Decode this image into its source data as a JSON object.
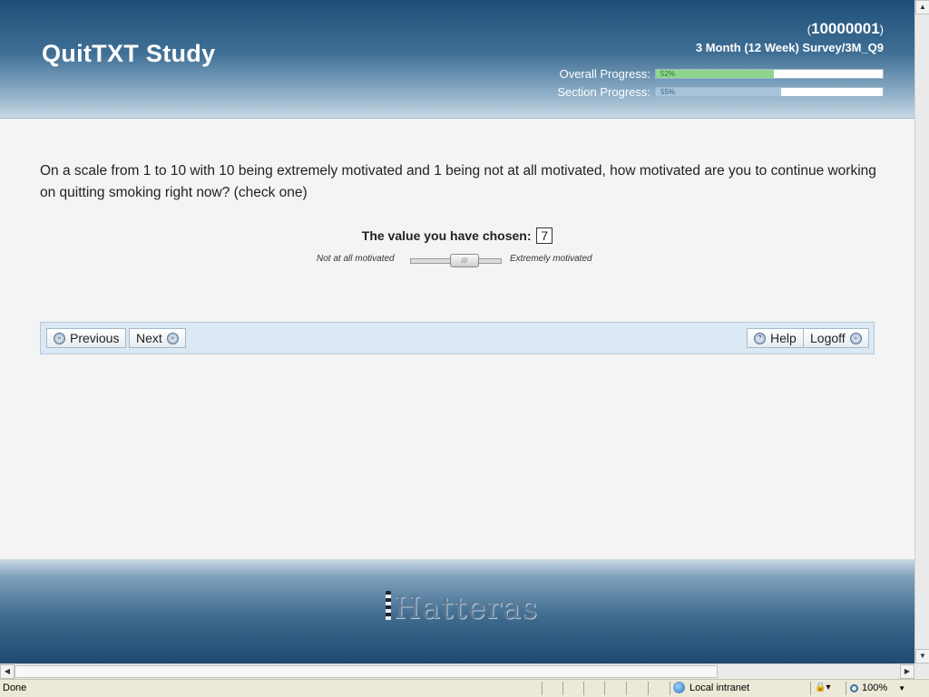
{
  "header": {
    "title": "QuitTXT Study",
    "participant_id_open": "(",
    "participant_id": "10000001",
    "participant_id_close": ")",
    "survey": "3 Month (12 Week) Survey/3M_Q9",
    "overall_progress_label": "Overall Progress:",
    "overall_progress_pct": 52,
    "overall_progress_text": "52%",
    "section_progress_label": "Section Progress:",
    "section_progress_pct": 55,
    "section_progress_text": "55%"
  },
  "question": {
    "text": "On a scale from 1 to 10 with 10 being extremely motivated and 1 being not at all motivated, how motivated are you to continue working on quitting smoking right now? (check one)",
    "chosen_label": "The value you have chosen:",
    "chosen_value": "7",
    "slider_min_label": "Not at all motivated",
    "slider_max_label": "Extremely motivated",
    "slider_value": 7,
    "slider_min": 1,
    "slider_max": 10,
    "slider_grip": "///"
  },
  "nav": {
    "previous": "Previous",
    "next": "Next",
    "help": "Help",
    "logoff": "Logoff",
    "prev_icon_glyph": "«",
    "next_icon_glyph": "»",
    "help_icon_glyph": "?"
  },
  "footer": {
    "logo": "Hatteras"
  },
  "scrollbars": {
    "up": "▲",
    "down": "▼",
    "left": "◀",
    "right": "▶"
  },
  "statusbar": {
    "status": "Done",
    "zone": "Local intranet",
    "zoom": "100%",
    "protected_mode_glyph": "🔒▾",
    "zoom_dropdown_glyph": "▼"
  },
  "colors": {
    "header_dark": "#1e4f78",
    "overall_fill": "#8fd58f",
    "section_fill": "#a9c4da",
    "navbar_bg": "#dce8f4"
  }
}
